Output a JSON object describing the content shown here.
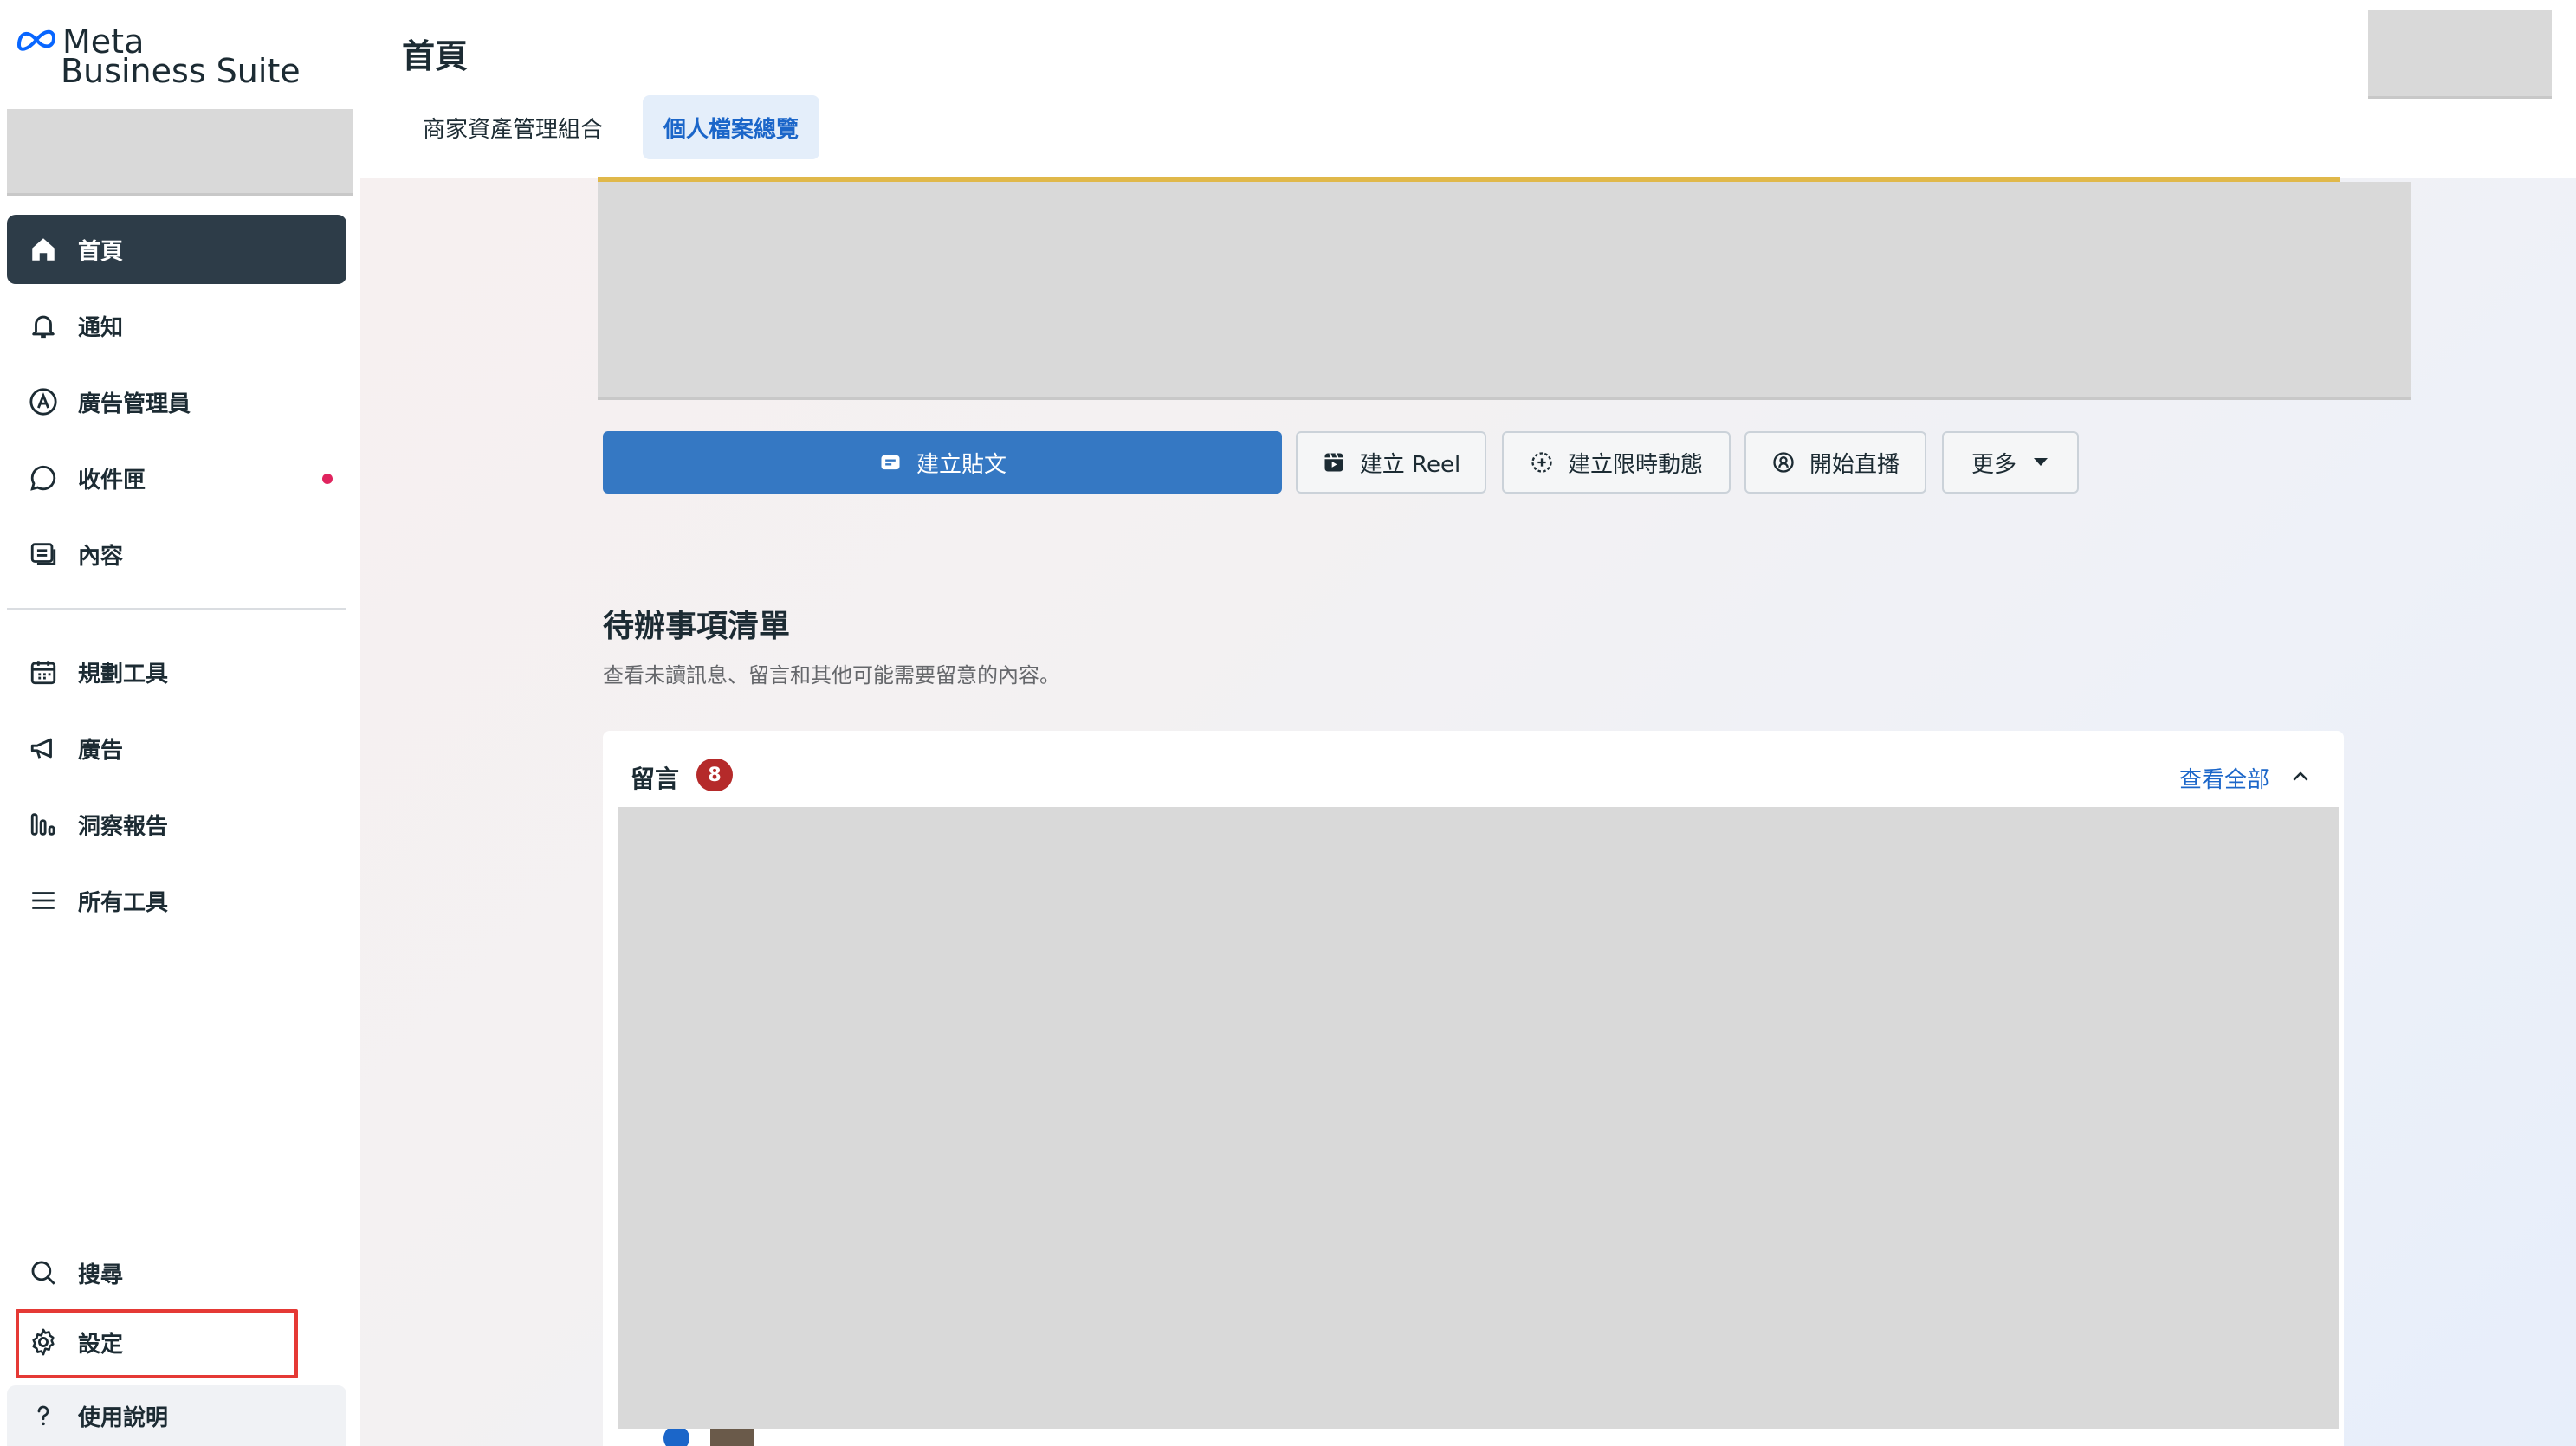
{
  "app": {
    "logo_line1": "Meta",
    "logo_line2": "Business Suite"
  },
  "sidebar": {
    "items": [
      {
        "label": "首頁",
        "icon": "home-icon"
      },
      {
        "label": "通知",
        "icon": "bell-icon"
      },
      {
        "label": "廣告管理員",
        "icon": "ads-manager-icon"
      },
      {
        "label": "收件匣",
        "icon": "chat-bubble-icon"
      },
      {
        "label": "內容",
        "icon": "content-icon"
      },
      {
        "label": "規劃工具",
        "icon": "calendar-icon"
      },
      {
        "label": "廣告",
        "icon": "megaphone-icon"
      },
      {
        "label": "洞察報告",
        "icon": "bar-chart-icon"
      },
      {
        "label": "所有工具",
        "icon": "menu-icon"
      },
      {
        "label": "搜尋",
        "icon": "search-icon"
      },
      {
        "label": "設定",
        "icon": "gear-icon"
      },
      {
        "label": "使用說明",
        "icon": "question-icon"
      }
    ]
  },
  "header": {
    "title": "首頁",
    "tabs": [
      {
        "label": "商家資產管理組合"
      },
      {
        "label": "個人檔案總覽"
      }
    ]
  },
  "actions": {
    "create_post": "建立貼文",
    "create_reel": "建立 Reel",
    "create_story": "建立限時動態",
    "go_live": "開始直播",
    "more": "更多"
  },
  "todo": {
    "title": "待辦事項清單",
    "subtitle": "查看未讀訊息、留言和其他可能需要留意的內容。",
    "card_title": "留言",
    "badge_count": "8",
    "view_all": "查看全部"
  },
  "colors": {
    "active_nav": "#2d3c48",
    "primary_button": "#3578c3",
    "link": "#1b66c9",
    "badge": "#b52a2a",
    "highlight": "#e53935"
  }
}
